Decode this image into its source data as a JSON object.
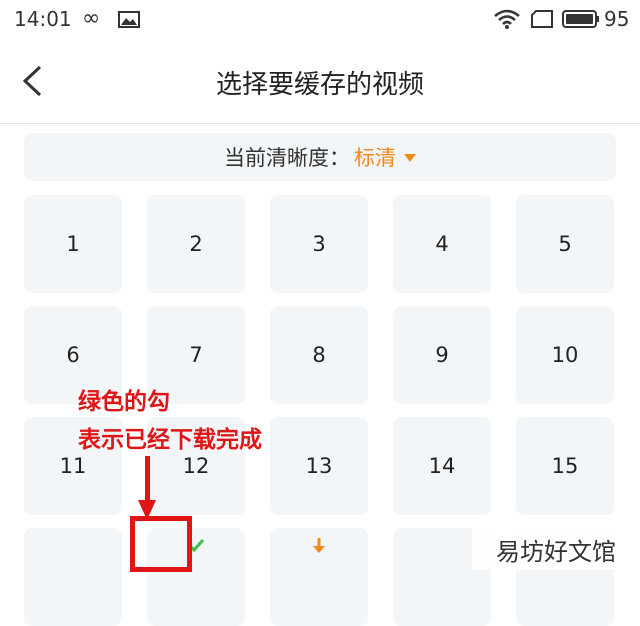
{
  "status_bar": {
    "time": "14:01",
    "battery_percent": "95"
  },
  "nav": {
    "title": "选择要缓存的视频"
  },
  "quality": {
    "label": "当前清晰度：",
    "value": "标清",
    "accent": "#f08a1c"
  },
  "episodes": [
    {
      "label": "1"
    },
    {
      "label": "2"
    },
    {
      "label": "3"
    },
    {
      "label": "4"
    },
    {
      "label": "5"
    },
    {
      "label": "6"
    },
    {
      "label": "7"
    },
    {
      "label": "8"
    },
    {
      "label": "9"
    },
    {
      "label": "10"
    },
    {
      "label": "11"
    },
    {
      "label": "12"
    },
    {
      "label": "13"
    },
    {
      "label": "14"
    },
    {
      "label": "15"
    },
    {
      "label": "",
      "state": "downloading-partial"
    },
    {
      "label": "",
      "state": "downloaded"
    },
    {
      "label": "",
      "state": "downloading"
    },
    {
      "label": "",
      "state": "none"
    },
    {
      "label": "",
      "state": "none"
    }
  ],
  "annotation": {
    "line1": "绿色的勾",
    "line2": "表示已经下载完成",
    "color": "#e01515"
  },
  "watermark": "易坊好文馆"
}
